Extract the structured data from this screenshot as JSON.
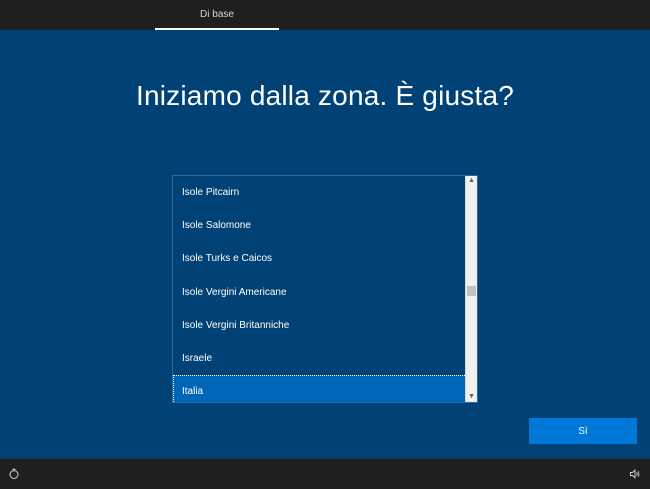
{
  "header": {
    "tab_label": "Di base"
  },
  "main": {
    "title": "Iniziamo dalla zona. È giusta?",
    "region_list": {
      "items": [
        "Isole Pitcairn",
        "Isole Salomone",
        "Isole Turks e Caicos",
        "Isole Vergini Americane",
        "Isole Vergini Britanniche",
        "Israele",
        "Italia"
      ],
      "selected": "Italia",
      "scroll_fraction": 0.51
    },
    "confirm_button_label": "Sì"
  },
  "footer": {
    "left_icon": "ease-of-access-icon",
    "right_icon": "volume-icon"
  }
}
